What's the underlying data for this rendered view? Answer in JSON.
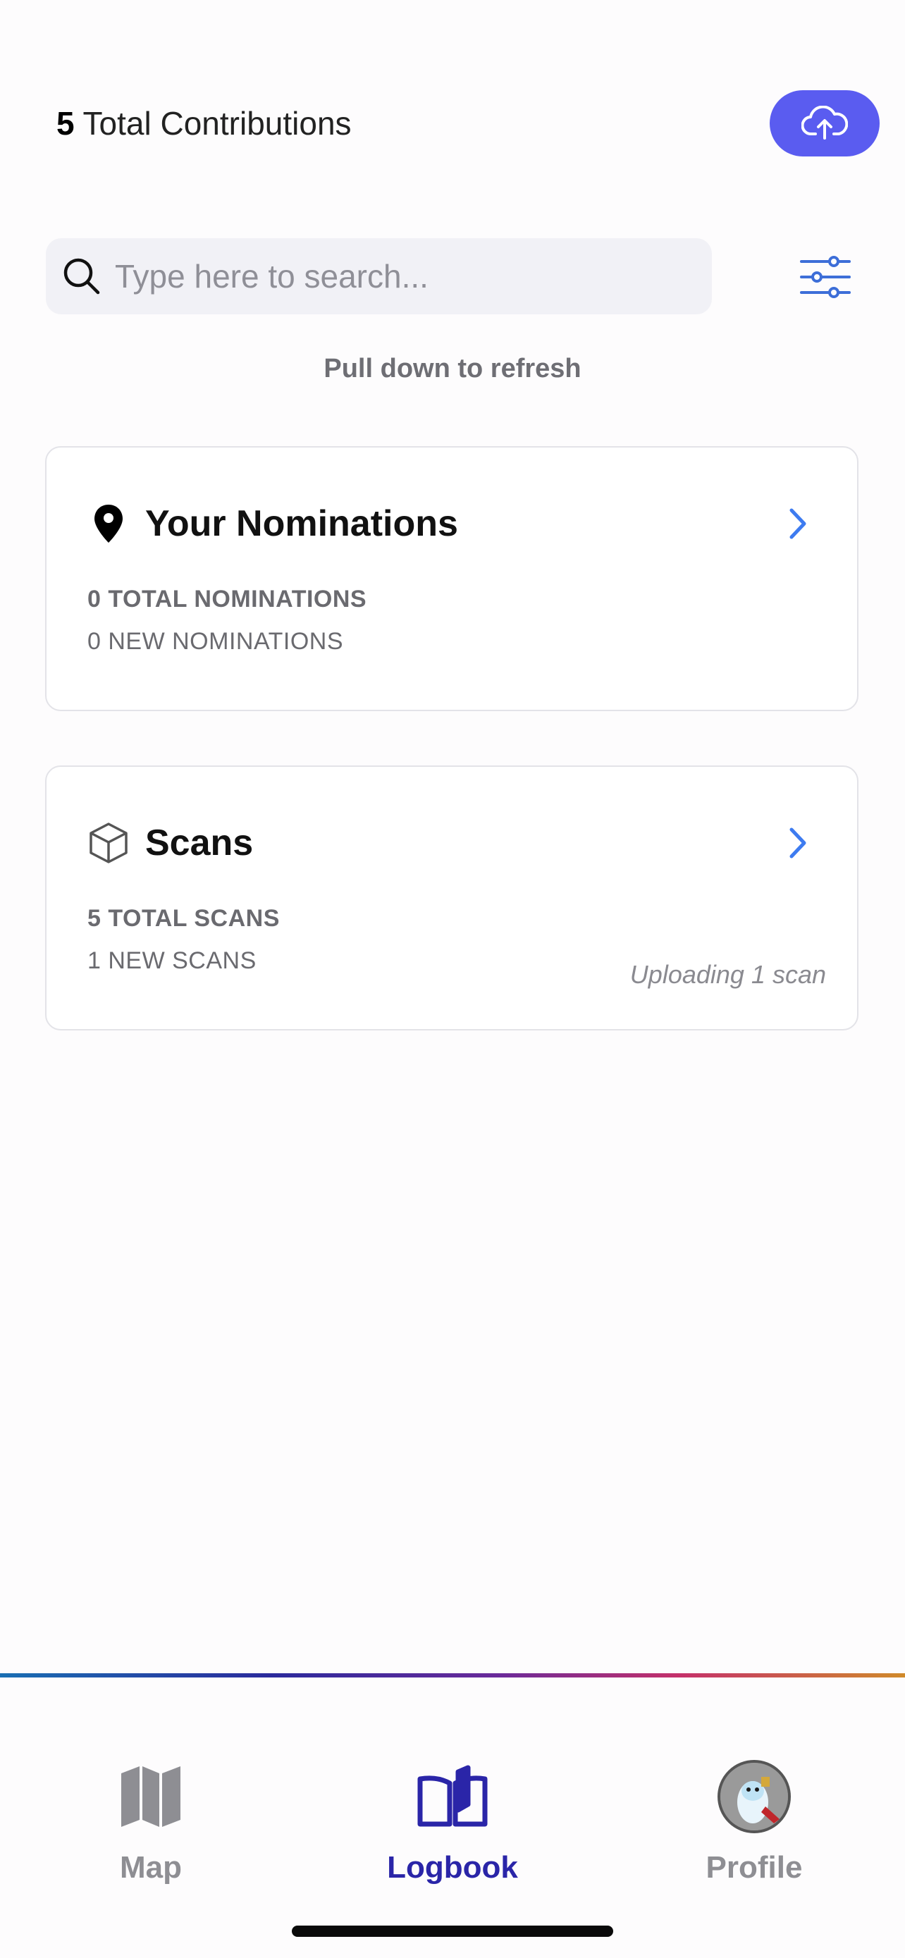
{
  "header": {
    "contributions_count": "5",
    "contributions_label": "Total Contributions",
    "upload_icon": "cloud-upload-icon"
  },
  "search": {
    "placeholder": "Type here to search...",
    "value": "",
    "icon": "search-icon",
    "filter_icon": "sliders-icon"
  },
  "refresh_hint": "Pull down to refresh",
  "cards": {
    "nominations": {
      "icon": "map-pin-icon",
      "title": "Your Nominations",
      "total": "0 TOTAL NOMINATIONS",
      "new": "0 NEW NOMINATIONS"
    },
    "scans": {
      "icon": "cube-icon",
      "title": "Scans",
      "total": "5 TOTAL SCANS",
      "new": "1 NEW SCANS",
      "status": "Uploading 1 scan"
    }
  },
  "tabbar": {
    "tabs": [
      {
        "label": "Map",
        "icon": "map-icon",
        "active": false
      },
      {
        "label": "Logbook",
        "icon": "book-icon",
        "active": true
      },
      {
        "label": "Profile",
        "icon": "avatar",
        "active": false
      }
    ]
  },
  "colors": {
    "accent": "#5a5cf0",
    "active_tab": "#2a25a8",
    "chevron": "#3d7bf0",
    "inactive_tab": "#8e8e93"
  }
}
